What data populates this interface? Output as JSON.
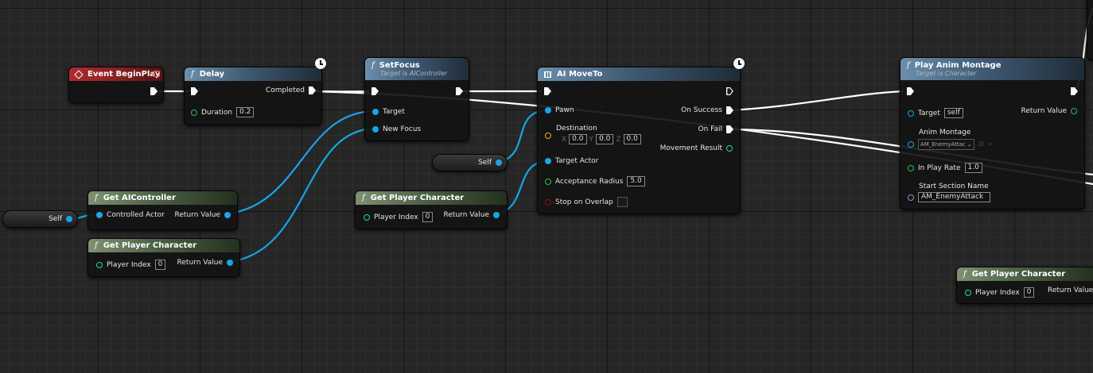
{
  "nodes": {
    "event_begin_play": {
      "title": "Event BeginPlay"
    },
    "delay": {
      "title": "Delay",
      "completed": "Completed",
      "duration_label": "Duration",
      "duration_value": "0.2"
    },
    "set_focus": {
      "title": "SetFocus",
      "subtitle": "Target is AIController",
      "target": "Target",
      "new_focus": "New Focus"
    },
    "ai_move_to": {
      "title": "AI MoveTo",
      "pawn": "Pawn",
      "destination": "Destination",
      "x_label": "X",
      "x_value": "0.0",
      "y_label": "Y",
      "y_value": "0.0",
      "z_label": "Z",
      "z_value": "0.0",
      "target_actor": "Target Actor",
      "acceptance_radius": "Acceptance Radius",
      "acceptance_radius_value": "5.0",
      "stop_on_overlap": "Stop on Overlap",
      "on_success": "On Success",
      "on_fail": "On Fail",
      "movement_result": "Movement Result"
    },
    "play_anim_montage": {
      "title": "Play Anim Montage",
      "subtitle": "Target is Character",
      "target": "Target",
      "target_value": "self",
      "anim_montage": "Anim Montage",
      "anim_montage_value": "AM_EnemyAttac",
      "in_play_rate": "In Play Rate",
      "in_play_rate_value": "1.0",
      "start_section": "Start Section Name",
      "start_section_value": "AM_EnemyAttack",
      "return_value": "Return Value"
    },
    "get_ai_controller": {
      "title": "Get AIController",
      "controlled_actor": "Controlled Actor",
      "return_value": "Return Value"
    },
    "get_player_character_1": {
      "title": "Get Player Character",
      "player_index": "Player Index",
      "player_index_value": "0",
      "return_value": "Return Value"
    },
    "get_player_character_2": {
      "title": "Get Player Character",
      "player_index": "Player Index",
      "player_index_value": "0",
      "return_value": "Return Value"
    },
    "get_player_character_3": {
      "title": "Get Player Character",
      "player_index": "Player Index",
      "player_index_value": "0",
      "return_value": "Return Value"
    },
    "self_1": {
      "label": "Self"
    },
    "self_2": {
      "label": "Self"
    }
  },
  "colors": {
    "exec": "#ffffff",
    "object": "#16a6e8",
    "float": "#31c243",
    "vector": "#e6b800",
    "bool": "#8c1414",
    "name": "#b07ad8",
    "int": "#1fd1b3"
  }
}
